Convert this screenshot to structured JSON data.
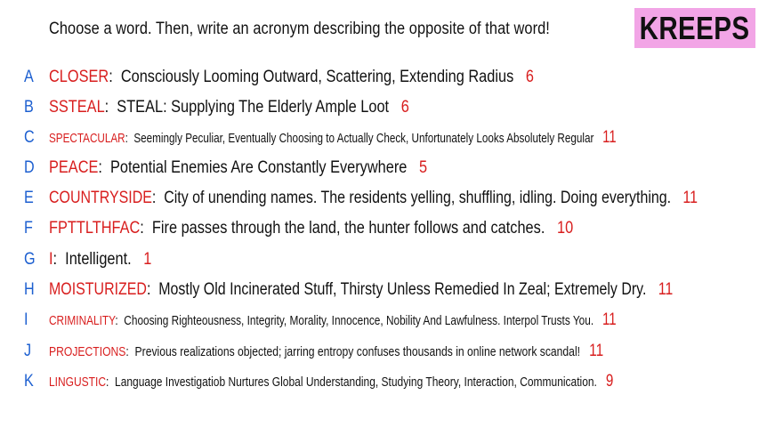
{
  "brand": "KREEPS",
  "prompt": "Choose a word. Then, write an acronym describing the opposite of that word!",
  "colors": {
    "letter": "#1c5fd0",
    "word": "#d81e1e",
    "score": "#d81e1e",
    "text": "#111111",
    "logo_bg": "#f2a5e6"
  },
  "entries": [
    {
      "letter": "A",
      "word": "CLOSER",
      "sep": ":",
      "acronym": "Consciously Looming Outward, Scattering, Extending Radius",
      "score": "6"
    },
    {
      "letter": "B",
      "word": "SSTEAL",
      "sep": ":",
      "acronym": "STEAL: Supplying The Elderly Ample Loot",
      "score": "6"
    },
    {
      "letter": "C",
      "word": "SPECTACULAR",
      "sep": ":",
      "acronym": "Seemingly Peculiar, Eventually Choosing to Actually Check, Unfortunately Looks Absolutely Regular",
      "score": "11"
    },
    {
      "letter": "D",
      "word": "PEACE",
      "sep": ":",
      "acronym": "Potential Enemies Are Constantly Everywhere",
      "score": "5"
    },
    {
      "letter": "E",
      "word": "COUNTRYSIDE",
      "sep": ":",
      "acronym": "City of unending names. The residents yelling, shuffling, idling. Doing everything.",
      "score": "11"
    },
    {
      "letter": "F",
      "word": "FPTTLTHFAC",
      "sep": ":",
      "acronym": "Fire passes through the land, the hunter follows and catches.",
      "score": "10"
    },
    {
      "letter": "G",
      "word": "I",
      "sep": ":",
      "acronym": "Intelligent.",
      "score": "1"
    },
    {
      "letter": "H",
      "word": "MOISTURIZED",
      "sep": ":",
      "acronym": "Mostly Old Incinerated Stuff, Thirsty Unless Remedied In Zeal; Extremely Dry.",
      "score": "11"
    },
    {
      "letter": "I",
      "word": "CRIMINALITY",
      "sep": ":",
      "acronym": "Choosing Righteousness, Integrity, Morality, Innocence, Nobility And Lawfulness. Interpol Trusts You.",
      "score": "11"
    },
    {
      "letter": "J",
      "word": "PROJECTIONS",
      "sep": ":",
      "acronym": "Previous realizations objected; jarring entropy confuses thousands in online network scandal!",
      "score": "11"
    },
    {
      "letter": "K",
      "word": "LINGUSTIC",
      "sep": ":",
      "acronym": "Language Investigatiob Nurtures Global Understanding, Studying Theory, Interaction, Communication.",
      "score": "9"
    }
  ]
}
